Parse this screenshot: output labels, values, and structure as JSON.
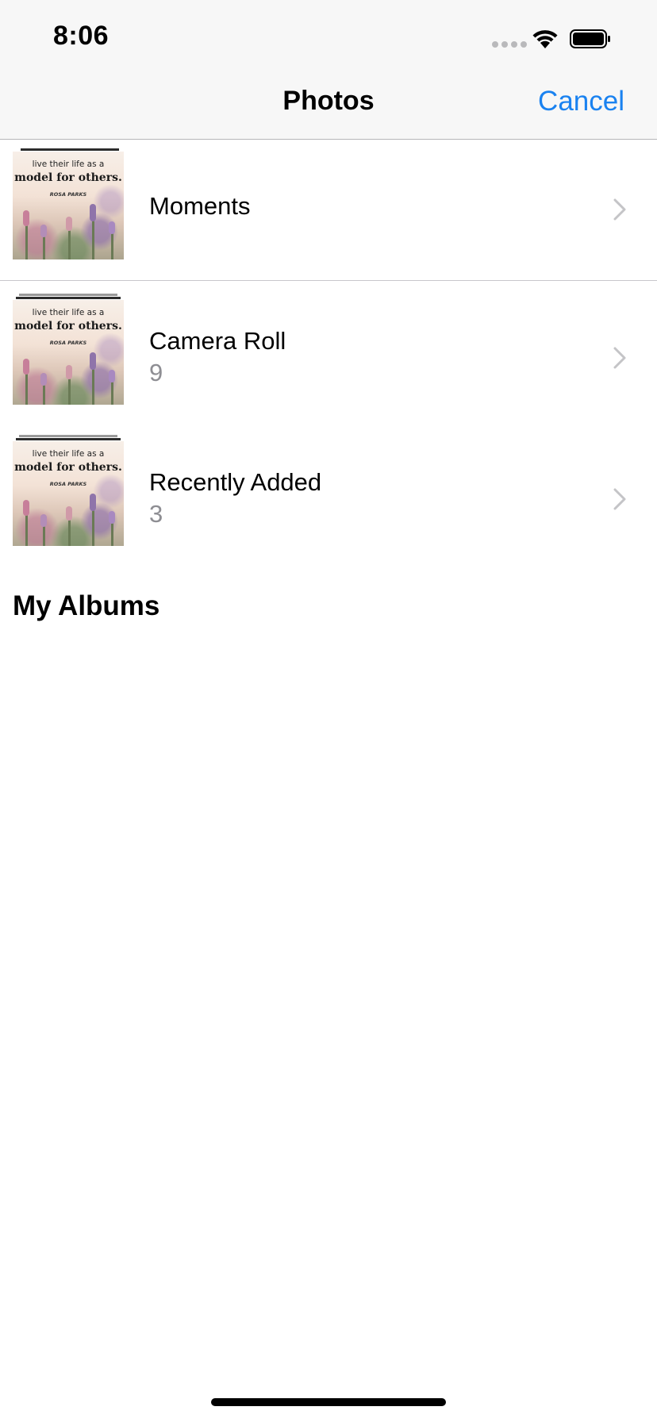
{
  "status_bar": {
    "time": "8:06"
  },
  "nav": {
    "title": "Photos",
    "cancel_label": "Cancel"
  },
  "thumbnail_text": {
    "line1": "live their life as a",
    "line2": "model for others.",
    "line3": "ROSA PARKS"
  },
  "albums": [
    {
      "title": "Moments",
      "count": ""
    },
    {
      "title": "Camera Roll",
      "count": "9"
    },
    {
      "title": "Recently Added",
      "count": "3"
    }
  ],
  "section": {
    "my_albums_title": "My Albums"
  },
  "colors": {
    "accent": "#1a82f0",
    "secondary_text": "#8e8e93",
    "chevron": "#c4c4c7"
  }
}
